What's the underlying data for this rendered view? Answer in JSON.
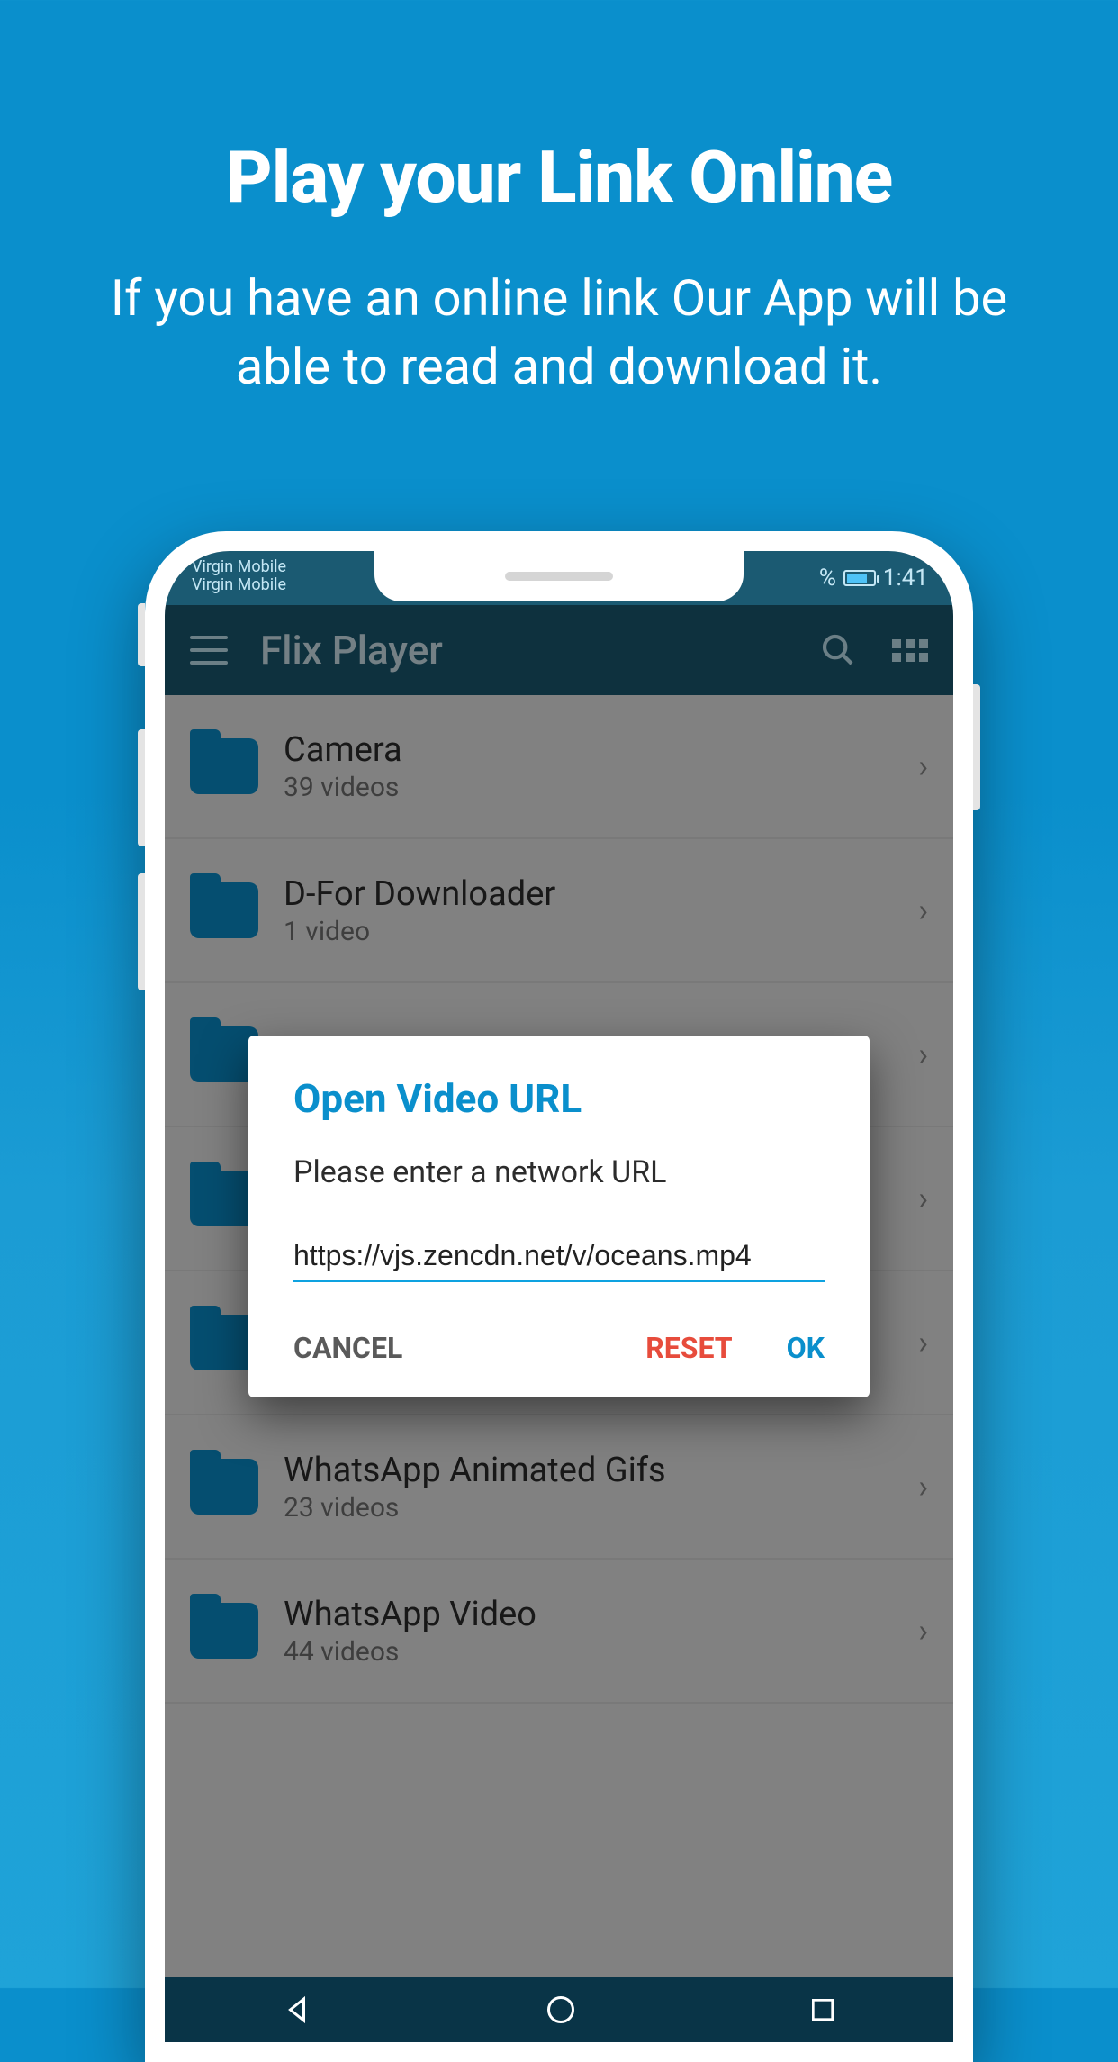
{
  "promo": {
    "title": "Play your Link Online",
    "subtitle": "If you have an online link Our App will be able to read and download it."
  },
  "status": {
    "carrier1": "Virgin Mobile",
    "carrier2": "Virgin Mobile",
    "percent": "%",
    "time": "1:41"
  },
  "header": {
    "title": "Flix Player"
  },
  "folders": [
    {
      "name": "Camera",
      "count": "39 videos"
    },
    {
      "name": "D-For Downloader",
      "count": "1 video"
    },
    {
      "name": "",
      "count": ""
    },
    {
      "name": "",
      "count": ""
    },
    {
      "name": "",
      "count": ""
    },
    {
      "name": "WhatsApp Animated Gifs",
      "count": "23 videos"
    },
    {
      "name": "WhatsApp Video",
      "count": "44 videos"
    }
  ],
  "dialog": {
    "title": "Open Video URL",
    "subtitle": "Please enter a network URL",
    "value": "https://vjs.zencdn.net/v/oceans.mp4",
    "cancel": "CANCEL",
    "reset": "RESET",
    "ok": "OK"
  }
}
